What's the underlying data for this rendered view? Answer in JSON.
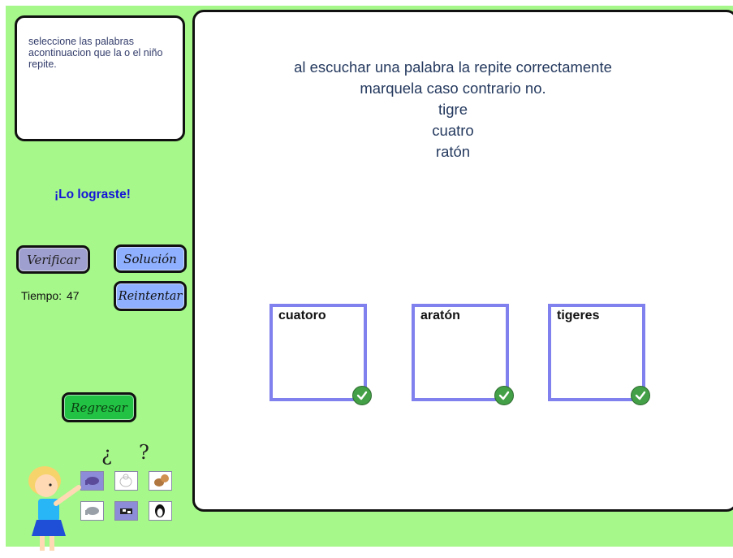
{
  "instructions": "seleccione las palabras acontinuacion que la o el niño repite.",
  "status": "¡Lo lograste!",
  "buttons": {
    "verify": "Verificar",
    "solution": "Solución",
    "retry": "Reintentar",
    "back": "Regresar"
  },
  "timer": {
    "label": "Tiempo:",
    "value": "47"
  },
  "question": {
    "line1": "al escuchar una palabra la repite correctamente",
    "line2": "marquela caso contrario no.",
    "words": [
      "tigre",
      "cuatro",
      "ratón"
    ]
  },
  "cards": [
    {
      "label": "cuatoro",
      "checked": true
    },
    {
      "label": "aratón",
      "checked": true
    },
    {
      "label": "tigeres",
      "checked": true
    }
  ],
  "decor": {
    "question_marks": [
      "¿",
      "?"
    ],
    "tile_icons": [
      "elephant-icon",
      "polar-bear-icon",
      "squirrel-icon",
      "elephant-icon",
      "cow-icon",
      "penguin-icon"
    ]
  },
  "colors": {
    "background": "#a6f88a",
    "card_border": "#8080ee",
    "status_text": "#1414d8",
    "check": "#43a047",
    "back_button": "#22c244",
    "blue_button": "#8fb0ff"
  }
}
